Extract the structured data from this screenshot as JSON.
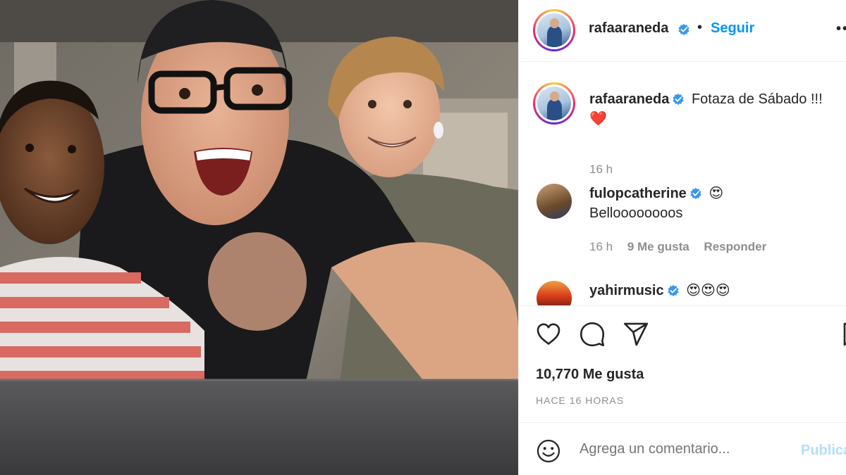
{
  "post": {
    "author": "rafaaraneda",
    "follow_label": "Seguir",
    "separator": "•",
    "more_label": "•••"
  },
  "comments": [
    {
      "username": "rafaaraneda",
      "text": "Fotaza de Sábado !!!",
      "emoji": "❤️",
      "time": "16 h"
    },
    {
      "username": "fulopcatherine",
      "emoji": "😍",
      "text": "Belloooooooos",
      "time": "16 h",
      "likes": "9 Me gusta",
      "reply_label": "Responder"
    },
    {
      "username": "yahirmusic",
      "emoji": "😍😍😍"
    }
  ],
  "engagement": {
    "likes": "10,770 Me gusta",
    "time_ago": "HACE 16 HORAS"
  },
  "composer": {
    "placeholder": "Agrega un comentario...",
    "post_label": "Publicar"
  },
  "icons": {
    "like": "heart-icon",
    "comment": "comment-bubble-icon",
    "share": "paper-plane-icon",
    "save": "bookmark-icon",
    "emoji": "smiley-icon",
    "verified": "verified-badge-icon"
  },
  "colors": {
    "accent": "#0095f6",
    "verified": "#3897f0",
    "muted": "#8e8e8e",
    "post_disabled": "#b2dffc"
  }
}
